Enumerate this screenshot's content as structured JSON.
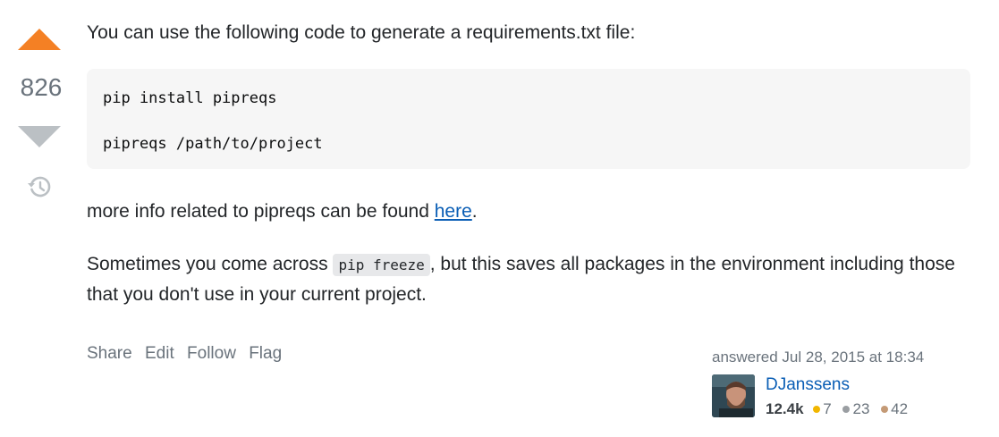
{
  "vote": {
    "count": "826"
  },
  "answer": {
    "intro": "You can use the following code to generate a requirements.txt file:",
    "code_lines": [
      "pip install pipreqs",
      "pipreqs /path/to/project"
    ],
    "para2_before": "more info related to pipreqs can be found ",
    "para2_link": "here",
    "para2_after": ".",
    "para3_before": "Sometimes you come across ",
    "para3_code": "pip freeze",
    "para3_after": ", but this saves all packages in the environment including those that you don't use in your current project."
  },
  "menu": {
    "share": "Share",
    "edit": "Edit",
    "follow": "Follow",
    "flag": "Flag"
  },
  "user": {
    "answered": "answered Jul 28, 2015 at 18:34",
    "name": "DJanssens",
    "reputation": "12.4k",
    "gold": "7",
    "silver": "23",
    "bronze": "42"
  },
  "colors": {
    "upvote": "#f48024",
    "downvote": "#bbc0c4",
    "link": "#0a5eb5",
    "gold": "#f1b600",
    "silver": "#9a9ea2",
    "bronze": "#c49a76"
  },
  "icons": [
    "upvote-arrow-icon",
    "downvote-arrow-icon",
    "history-icon"
  ]
}
